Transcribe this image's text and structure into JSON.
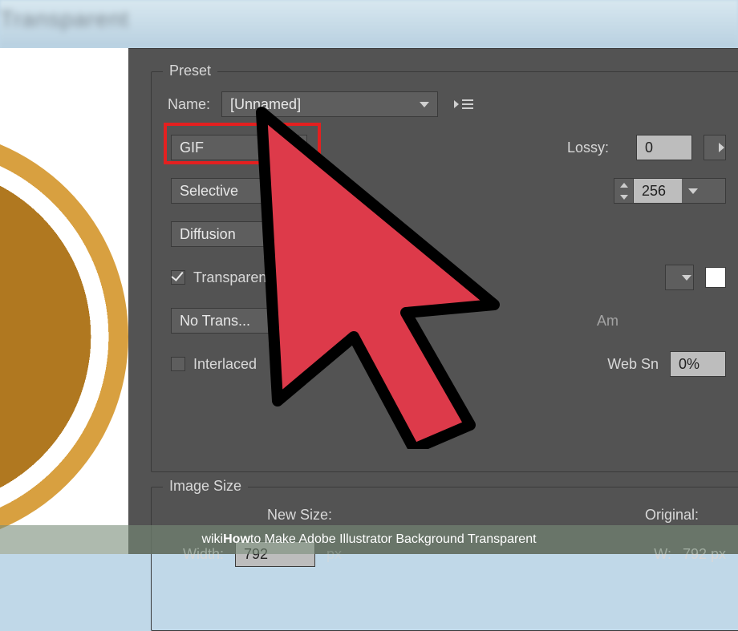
{
  "window": {
    "blur_title": "Transparent"
  },
  "preset": {
    "legend": "Preset",
    "name_label": "Name:",
    "name_value": "[Unnamed]",
    "format": "GIF",
    "lossy_label": "Lossy:",
    "lossy_value": "0",
    "reduction": "Selective",
    "colors_value": "256",
    "dither": "Diffusion",
    "transparency_label": "Transparency",
    "transparency_checked": true,
    "trans_dither": "No Trans...",
    "amount_label": "Am",
    "interlaced_label": "Interlaced",
    "interlaced_checked": false,
    "websnap_label": "Web Sn",
    "websnap_value": "0%"
  },
  "image_size": {
    "legend": "Image Size",
    "new_size_label": "New Size:",
    "original_label": "Original:",
    "width_label": "Width:",
    "width_value": "792",
    "unit": "px",
    "orig_w_label": "W:",
    "orig_w_value": "792 px"
  },
  "caption": {
    "prefix": "wiki",
    "bold": "How",
    "rest": " to Make Adobe Illustrator Background Transparent"
  }
}
